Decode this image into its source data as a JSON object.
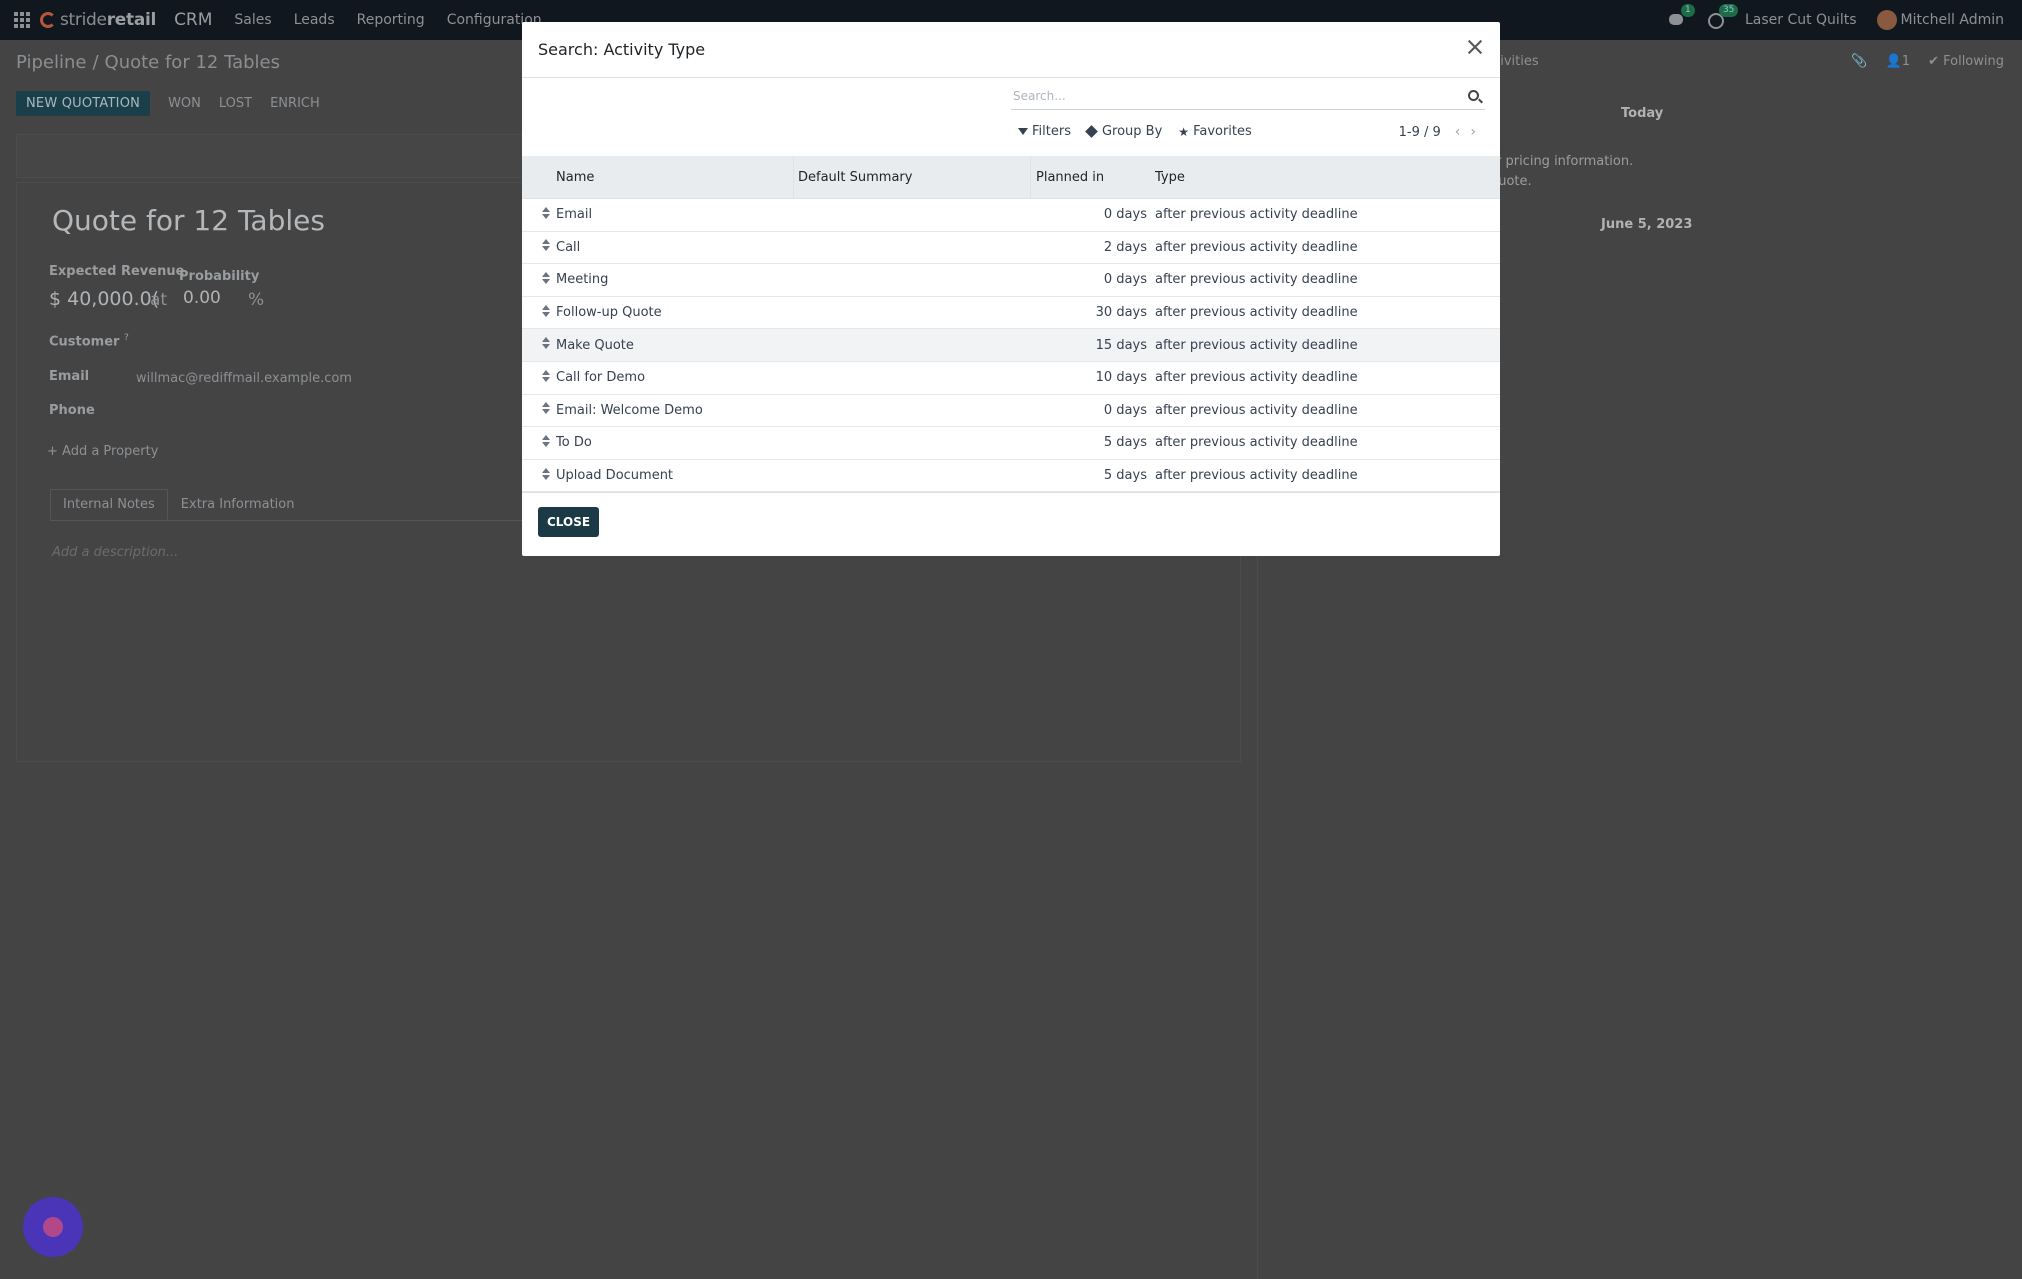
{
  "topnav": {
    "brand_prefix": "stride",
    "brand_suffix": "retail",
    "app": "CRM",
    "menu": [
      "Sales",
      "Leads",
      "Reporting",
      "Configuration"
    ],
    "chat_badge": "1",
    "activity_badge": "35",
    "company": "Laser Cut Quilts",
    "user": "Mitchell Admin"
  },
  "breadcrumb": {
    "parent": "Pipeline",
    "current": "Quote for 12 Tables"
  },
  "actions": {
    "new_quotation": "NEW QUOTATION",
    "won": "WON",
    "lost": "LOST",
    "enrich": "ENRICH"
  },
  "form": {
    "title": "Quote for 12 Tables",
    "expected_revenue_label": "Expected Revenue",
    "expected_revenue": "$ 40,000.0(",
    "at": "at",
    "probability_label": "Probability",
    "probability": "0.00",
    "percent": "%",
    "customer_label": "Customer",
    "customer_help": "?",
    "email_label": "Email",
    "email": "willmac@rediffmail.example.com",
    "phone_label": "Phone",
    "add_property": "Add a Property",
    "tabs": [
      "Internal Notes",
      "Extra Information"
    ],
    "description_placeholder": "Add a description..."
  },
  "chatter": {
    "activities_partial": "ctivities",
    "followers": "1",
    "following": "Following",
    "day1": "Today",
    "msg_line1": "er pricing information.",
    "msg_line2": "Quote.",
    "day2": "June 5, 2023"
  },
  "modal": {
    "title": "Search: Activity Type",
    "search_placeholder": "Search...",
    "filters": "Filters",
    "group_by": "Group By",
    "favorites": "Favorites",
    "pager": "1-9 / 9",
    "columns": [
      "Name",
      "Default Summary",
      "Planned in",
      "Type"
    ],
    "rows": [
      {
        "name": "Email",
        "summary": "",
        "planned": "0 days",
        "type": "after previous activity deadline"
      },
      {
        "name": "Call",
        "summary": "",
        "planned": "2 days",
        "type": "after previous activity deadline"
      },
      {
        "name": "Meeting",
        "summary": "",
        "planned": "0 days",
        "type": "after previous activity deadline"
      },
      {
        "name": "Follow-up Quote",
        "summary": "",
        "planned": "30 days",
        "type": "after previous activity deadline"
      },
      {
        "name": "Make Quote",
        "summary": "",
        "planned": "15 days",
        "type": "after previous activity deadline"
      },
      {
        "name": "Call for Demo",
        "summary": "",
        "planned": "10 days",
        "type": "after previous activity deadline"
      },
      {
        "name": "Email: Welcome Demo",
        "summary": "",
        "planned": "0 days",
        "type": "after previous activity deadline"
      },
      {
        "name": "To Do",
        "summary": "",
        "planned": "5 days",
        "type": "after previous activity deadline"
      },
      {
        "name": "Upload Document",
        "summary": "",
        "planned": "5 days",
        "type": "after previous activity deadline"
      }
    ],
    "close_label": "CLOSE"
  }
}
